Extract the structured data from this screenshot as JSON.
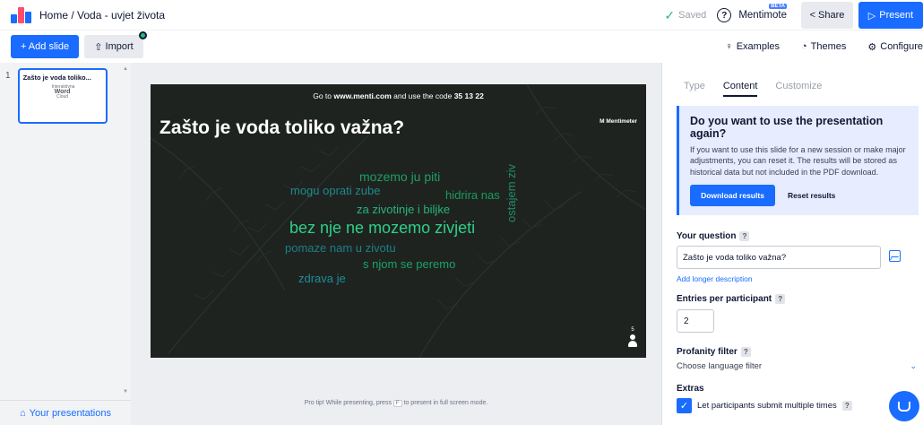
{
  "topbar": {
    "breadcrumb": "Home / Voda - uvjet života",
    "saved_label": "Saved",
    "help_label": "?",
    "mentimote_label": "Mentimote",
    "beta_label": "BETA",
    "share_label": "Share",
    "present_label": "Present"
  },
  "toolbar": {
    "add_slide_label": "+ Add slide",
    "import_label": "Import",
    "examples_label": "Examples",
    "themes_label": "Themes",
    "configure_label": "Configure"
  },
  "slides_panel": {
    "items": [
      {
        "number": "1",
        "title": "Zašto je voda toliko...",
        "thumb_line1": "Interaktivna",
        "thumb_line2": "Word",
        "thumb_line3": "Cloud"
      }
    ],
    "your_presentations_label": "Your presentations"
  },
  "slide": {
    "instruction_prefix": "Go to ",
    "instruction_url": "www.menti.com",
    "instruction_mid": " and use the code ",
    "instruction_code": "35 13 22",
    "title": "Zašto je voda toliko važna?",
    "brand": "Mentimeter",
    "participants": "5",
    "words": [
      {
        "text": "mozemo ju piti",
        "color": "#1f9e63"
      },
      {
        "text": "mogu oprati zube",
        "color": "#1e8a8a"
      },
      {
        "text": "hidrira nas",
        "color": "#1a9c5c"
      },
      {
        "text": "za zivotinje i biljke",
        "color": "#24b57a"
      },
      {
        "text": "bez nje ne mozemo zivjeti",
        "color": "#2fcf88"
      },
      {
        "text": "pomaze nam u zivotu",
        "color": "#1c7f86"
      },
      {
        "text": "s njom se peremo",
        "color": "#1aa36a"
      },
      {
        "text": "zdrava je",
        "color": "#1f8c9a"
      },
      {
        "text": "ostajem ziv",
        "color": "#1f8c6a"
      }
    ]
  },
  "pro_tip": {
    "prefix": "Pro tip! While presenting, press ",
    "key": "F",
    "suffix": " to present in full screen mode."
  },
  "right_panel": {
    "tabs": [
      "Type",
      "Content",
      "Customize"
    ],
    "info": {
      "title": "Do you want to use the presentation again?",
      "body": "If you want to use this slide for a new session or make major adjustments, you can reset it. The results will be stored as historical data but not included in the PDF download.",
      "download_label": "Download results",
      "reset_label": "Reset results"
    },
    "question_label": "Your question",
    "question_value": "Zašto je voda toliko važna?",
    "longer_description_label": "Add longer description",
    "entries_label": "Entries per participant",
    "entries_value": "2",
    "profanity_label": "Profanity filter",
    "profanity_value": "Choose language filter",
    "extras_label": "Extras",
    "multiple_label": "Let participants submit multiple times",
    "help_badge": "?"
  },
  "colors": {
    "accent": "#196cff",
    "slide_bg": "#1f2320",
    "saved_check": "#2fb97b"
  }
}
